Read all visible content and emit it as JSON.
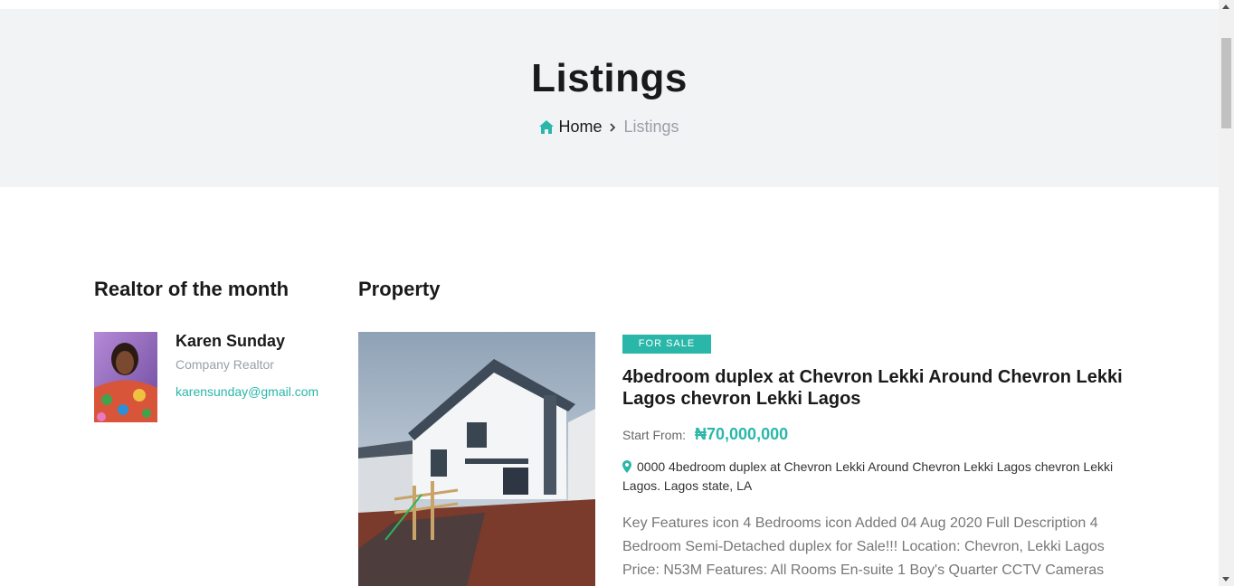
{
  "hero": {
    "title": "Listings",
    "breadcrumb": {
      "home": "Home",
      "current": "Listings"
    }
  },
  "sidebar": {
    "heading": "Realtor of the month",
    "realtor": {
      "name": "Karen Sunday",
      "role": "Company Realtor",
      "email": "karensunday@gmail.com"
    }
  },
  "main": {
    "heading": "Property",
    "listing": {
      "badge": "FOR SALE",
      "title": "4bedroom duplex at Chevron Lekki Around Chevron Lekki Lagos chevron Lekki Lagos",
      "price_label": "Start From:",
      "price": "₦70,000,000",
      "address": "0000 4bedroom duplex at Chevron Lekki Around Chevron Lekki Lagos chevron Lekki Lagos. Lagos state, LA",
      "description": "Key Features icon 4 Bedrooms icon Added 04 Aug 2020 Full Description 4 Bedroom Semi-Detached duplex for Sale!!! Location: Chevron, Lekki Lagos Price: N53M Features: All Rooms En-suite 1 Boy's Quarter CCTV Cameras"
    }
  },
  "colors": {
    "accent": "#2ab7a9",
    "hero_bg": "#f2f3f5"
  },
  "icons": {
    "breadcrumb_home": "home-icon",
    "breadcrumb_sep": "chevron-right-icon",
    "address": "map-pin-icon"
  }
}
